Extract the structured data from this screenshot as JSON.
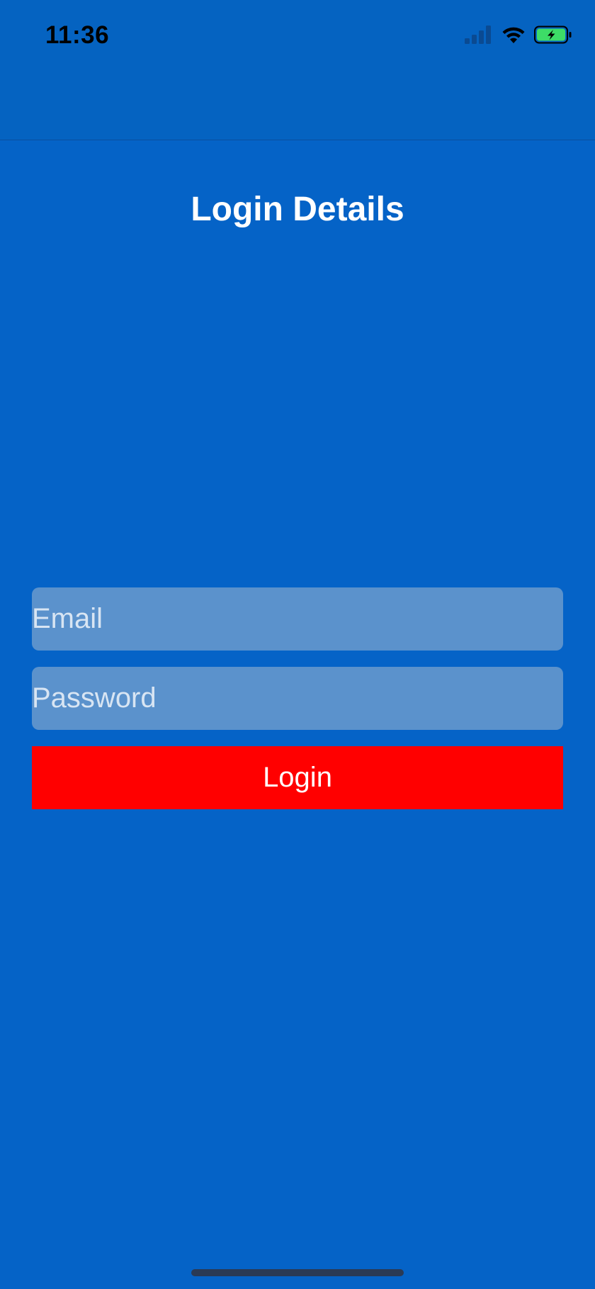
{
  "status_bar": {
    "time": "11:36",
    "icons": [
      "cellular-signal-icon",
      "wifi-icon",
      "battery-charging-icon"
    ]
  },
  "page": {
    "title": "Login Details"
  },
  "form": {
    "email_placeholder": "Email",
    "email_value": "",
    "password_placeholder": "Password",
    "password_value": "",
    "login_label": "Login"
  },
  "colors": {
    "background": "#0563c7",
    "field_background": "#5b92cc",
    "login_button": "#ff0000",
    "text": "#ffffff"
  }
}
